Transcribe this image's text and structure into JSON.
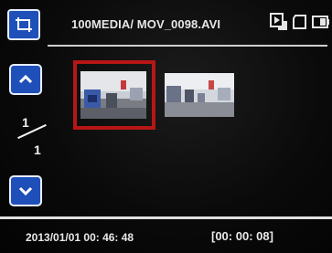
{
  "header": {
    "path": "100MEDIA/ MOV_0098.AVI",
    "mode_icon": "crop-frame-icon",
    "status_icons": [
      "video-file-icon",
      "sd-card-icon",
      "battery-icon"
    ]
  },
  "navigation": {
    "up_icon": "chevron-up-icon",
    "down_icon": "chevron-down-icon",
    "page_current": "1",
    "page_total": "1"
  },
  "thumbnails": [
    {
      "selected": true
    },
    {
      "selected": false
    }
  ],
  "footer": {
    "datetime": "2013/01/01 00: 46: 48",
    "duration": "[00: 00: 08]"
  },
  "colors": {
    "button_blue": "#1f4fb8",
    "selection_red": "#b81616",
    "text": "#e6e6e6"
  }
}
